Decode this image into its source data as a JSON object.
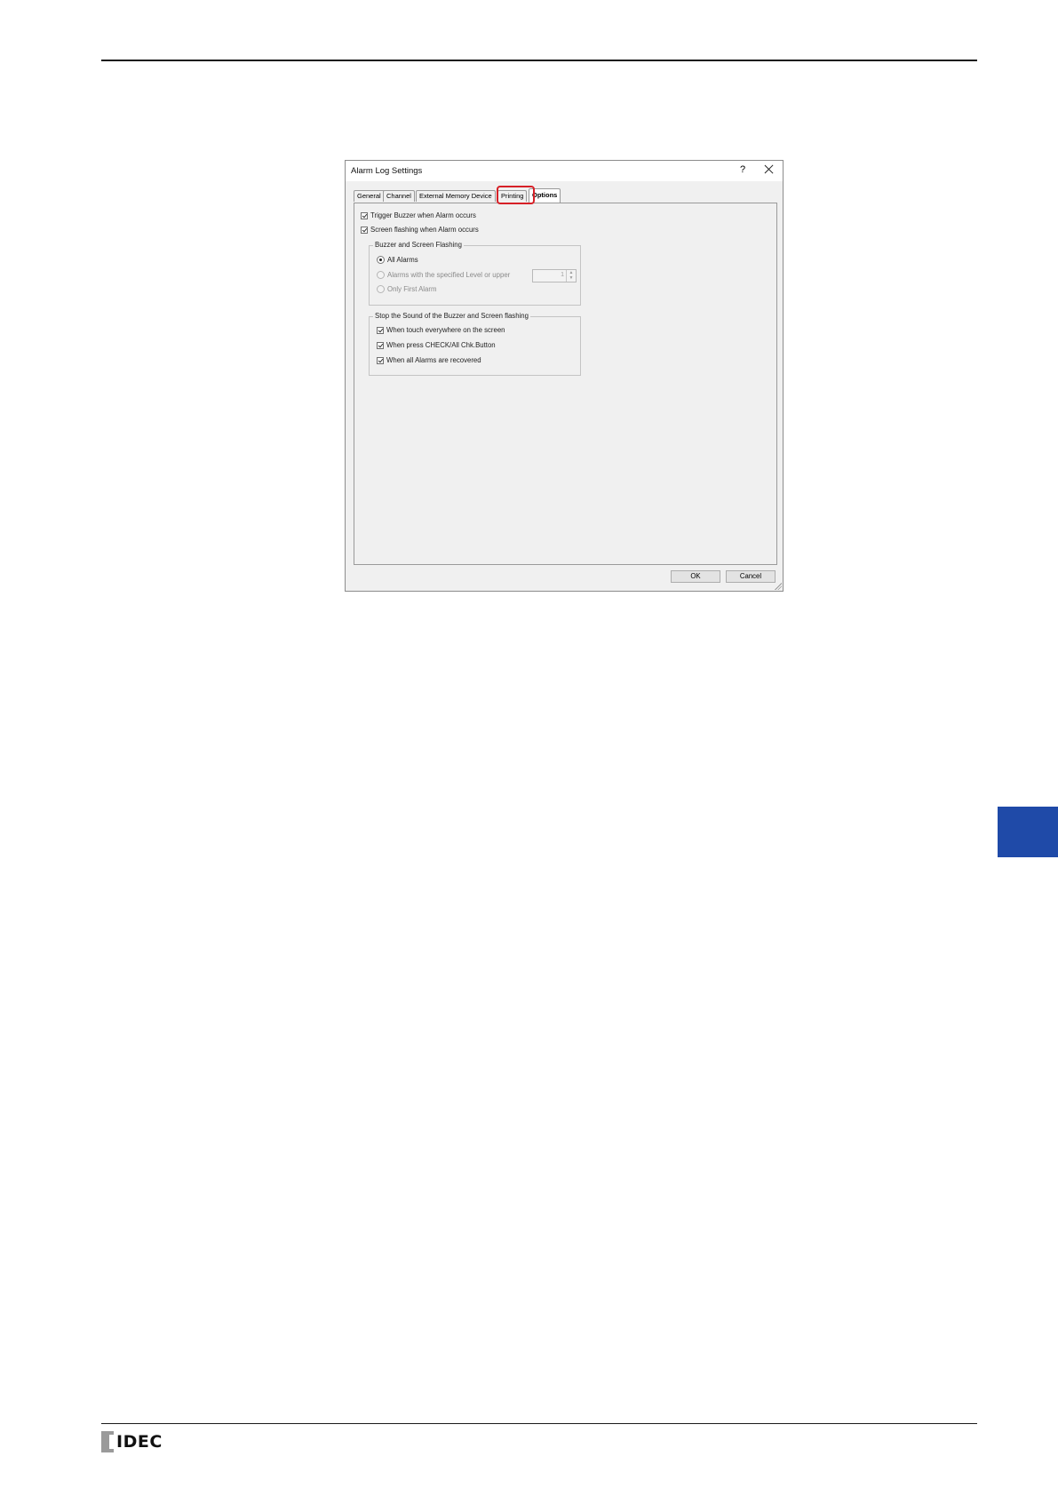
{
  "dialog": {
    "title": "Alarm Log Settings",
    "help": "?",
    "tabs": [
      {
        "label": "General"
      },
      {
        "label": "Channel"
      },
      {
        "label": "External Memory Device"
      },
      {
        "label": "Printing"
      },
      {
        "label": "Options",
        "active": true
      }
    ],
    "highlighted_tab": "Printing",
    "options": {
      "trigger_buzzer": {
        "label": "Trigger Buzzer when Alarm occurs",
        "checked": true
      },
      "screen_flashing": {
        "label": "Screen flashing when Alarm occurs",
        "checked": true
      }
    },
    "group_buzzer": {
      "label": "Buzzer and Screen Flashing",
      "all_alarms": {
        "label": "All Alarms",
        "selected": true
      },
      "specified_level": {
        "label": "Alarms with the specified Level or upper",
        "selected": false,
        "enabled": false,
        "value": "1"
      },
      "only_first": {
        "label": "Only First Alarm",
        "selected": false,
        "enabled": false
      }
    },
    "group_stop": {
      "label": "Stop the Sound of the Buzzer and Screen flashing",
      "touch": {
        "label": "When touch everywhere on the screen",
        "checked": true
      },
      "check_button": {
        "label": "When press CHECK/All Chk.Button",
        "checked": true
      },
      "recovered": {
        "label": "When all Alarms are recovered",
        "checked": true
      }
    },
    "buttons": {
      "ok": "OK",
      "cancel": "Cancel"
    }
  },
  "footer": {
    "logo": "IDEC"
  },
  "colors": {
    "accent_tab": "#1f4aa8",
    "highlight": "#d62027"
  }
}
